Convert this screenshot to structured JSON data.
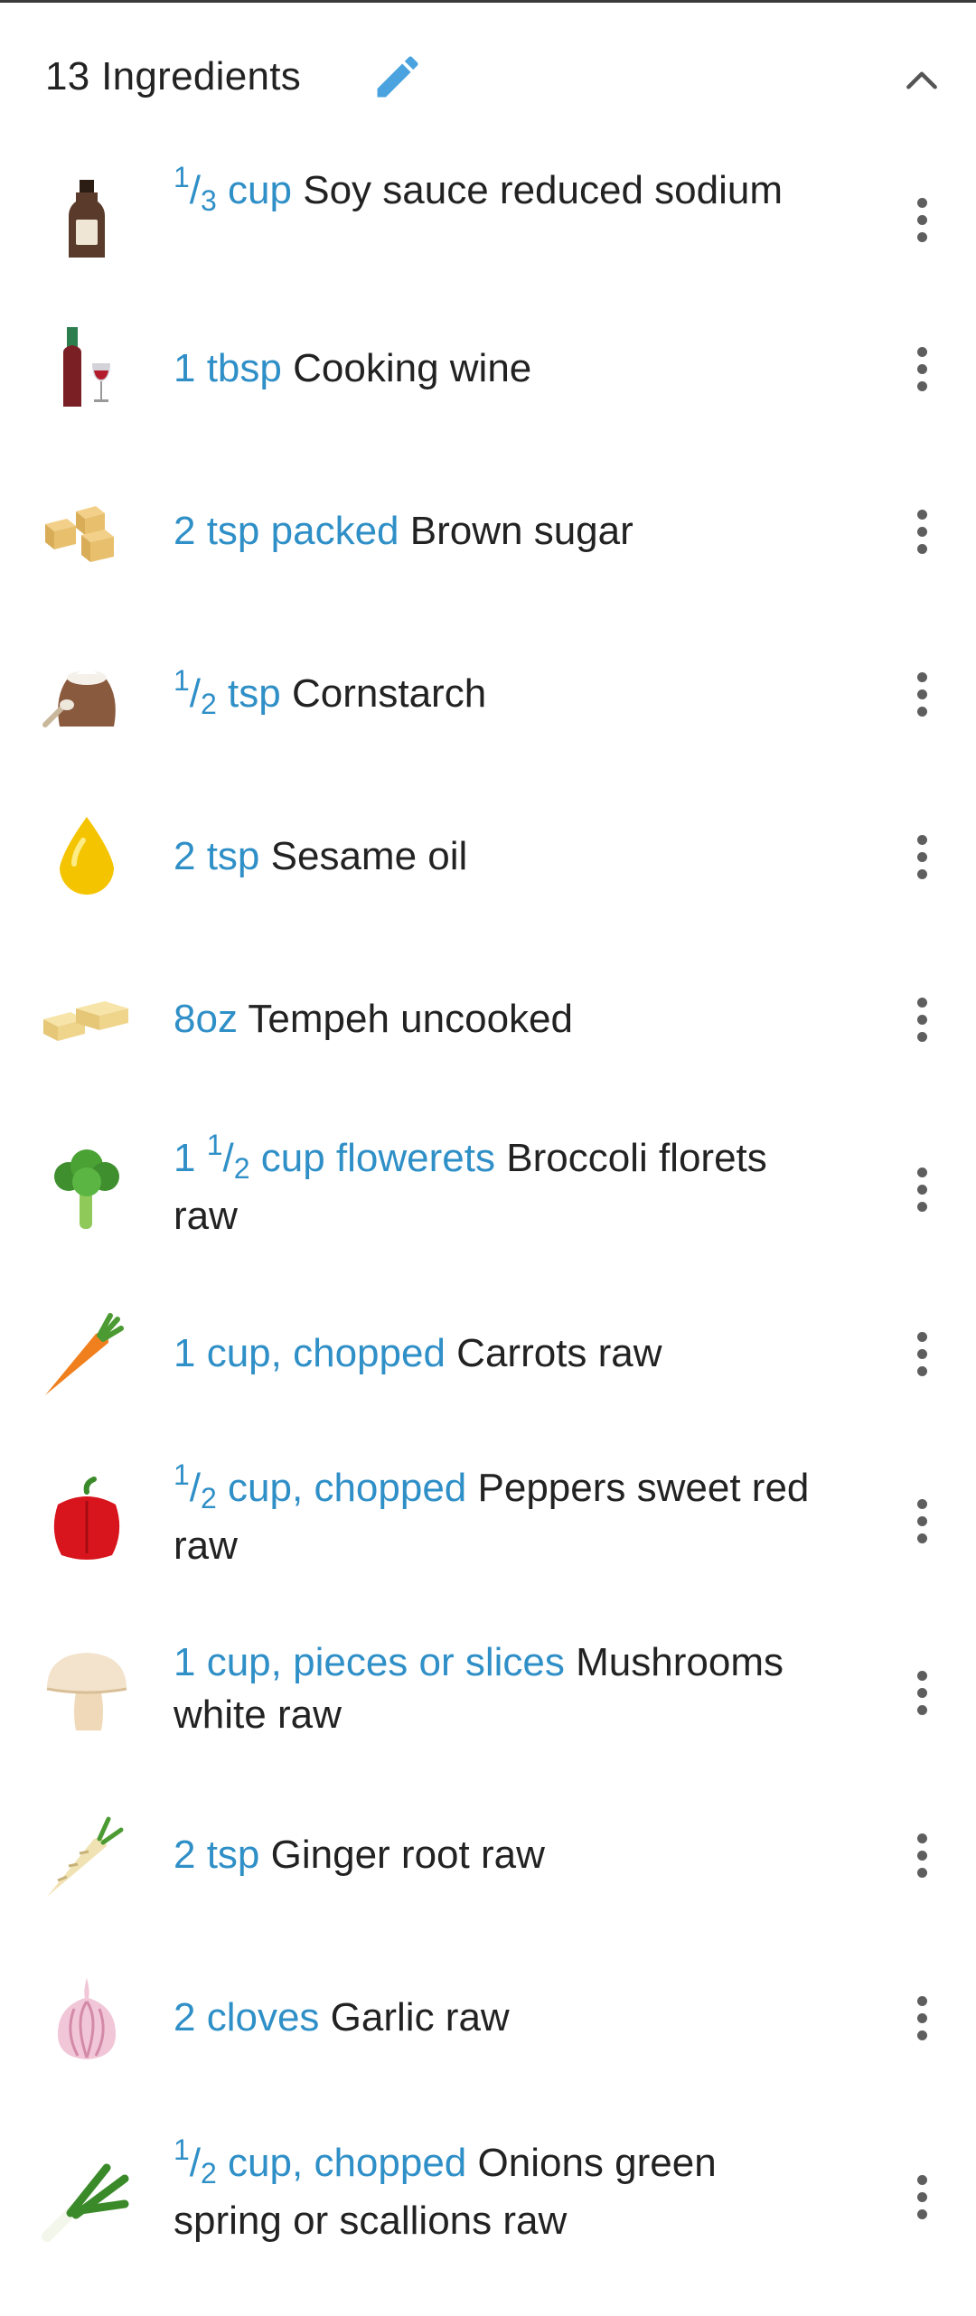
{
  "header": {
    "title": "13 Ingredients",
    "edit_icon": "pencil-icon",
    "collapse_icon": "chevron-up-icon"
  },
  "colors": {
    "quantity": "#2f8fc7",
    "name": "#222222",
    "accent": "#4aa3df"
  },
  "ingredients": [
    {
      "icon": "soy-sauce-bottle-icon",
      "qty_num": "1",
      "qty_den": "3",
      "qty_whole": "",
      "qty_rest": " cup",
      "name": "Soy sauce reduced sodium"
    },
    {
      "icon": "wine-bottle-glass-icon",
      "qty_num": "",
      "qty_den": "",
      "qty_whole": "1",
      "qty_rest": " tbsp",
      "name": "Cooking wine"
    },
    {
      "icon": "sugar-cubes-icon",
      "qty_num": "",
      "qty_den": "",
      "qty_whole": "2",
      "qty_rest": " tsp packed",
      "name": "Brown sugar"
    },
    {
      "icon": "flour-sack-icon",
      "qty_num": "1",
      "qty_den": "2",
      "qty_whole": "",
      "qty_rest": " tsp",
      "name": "Cornstarch"
    },
    {
      "icon": "oil-drop-icon",
      "qty_num": "",
      "qty_den": "",
      "qty_whole": "2",
      "qty_rest": " tsp",
      "name": "Sesame oil"
    },
    {
      "icon": "tempeh-blocks-icon",
      "qty_num": "",
      "qty_den": "",
      "qty_whole": "8oz",
      "qty_rest": "",
      "name": "Tempeh uncooked"
    },
    {
      "icon": "broccoli-icon",
      "qty_num": "1",
      "qty_den": "2",
      "qty_whole": "1 ",
      "qty_rest": " cup flowerets",
      "name": "Broccoli florets raw"
    },
    {
      "icon": "carrot-icon",
      "qty_num": "",
      "qty_den": "",
      "qty_whole": "1",
      "qty_rest": " cup, chopped",
      "name": "Carrots raw"
    },
    {
      "icon": "red-pepper-icon",
      "qty_num": "1",
      "qty_den": "2",
      "qty_whole": "",
      "qty_rest": " cup, chopped",
      "name": "Peppers sweet red raw"
    },
    {
      "icon": "mushroom-icon",
      "qty_num": "",
      "qty_den": "",
      "qty_whole": "1",
      "qty_rest": " cup, pieces or slices",
      "name": "Mushrooms white raw"
    },
    {
      "icon": "ginger-root-icon",
      "qty_num": "",
      "qty_den": "",
      "qty_whole": "2",
      "qty_rest": " tsp",
      "name": "Ginger root raw"
    },
    {
      "icon": "garlic-icon",
      "qty_num": "",
      "qty_den": "",
      "qty_whole": "2",
      "qty_rest": " cloves",
      "name": "Garlic raw"
    },
    {
      "icon": "green-onion-icon",
      "qty_num": "1",
      "qty_den": "2",
      "qty_whole": "",
      "qty_rest": " cup, chopped",
      "name": "Onions green spring or scallions raw"
    }
  ],
  "row_menu_icon": "more-vertical-icon"
}
